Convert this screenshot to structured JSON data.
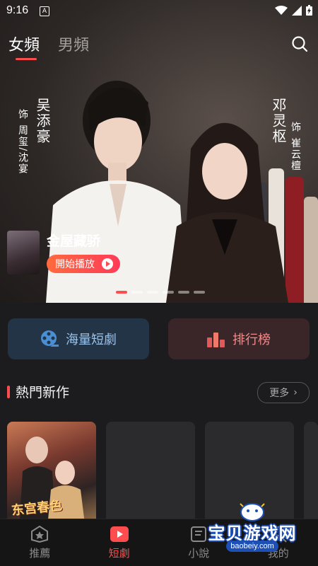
{
  "status_bar": {
    "time": "9:16",
    "app_badge": "A"
  },
  "tabs": [
    {
      "label": "女頻",
      "active": true
    },
    {
      "label": "男頻",
      "active": false
    }
  ],
  "hero": {
    "actor1_name": "吴添豪",
    "actor1_role": "饰 周玺/沈宴",
    "actor2_name": "邓灵枢",
    "actor2_role": "饰 崔云檀",
    "drama_title": "金屋藏骄",
    "play_label": "開始播放",
    "carousel_count": 6,
    "carousel_active_index": 0
  },
  "quick_actions": [
    {
      "label": "海量短劇",
      "icon": "film-reel-icon"
    },
    {
      "label": "排行榜",
      "icon": "ranking-icon"
    }
  ],
  "section": {
    "title": "熱門新作",
    "more_label": "更多"
  },
  "cards": [
    {
      "title": "东宫春色"
    }
  ],
  "nav": [
    {
      "label": "推薦",
      "icon": "recommend-icon",
      "active": false
    },
    {
      "label": "短劇",
      "icon": "play-icon",
      "active": true
    },
    {
      "label": "小說",
      "icon": "book-icon",
      "active": false
    },
    {
      "label": "我的",
      "icon": "profile-icon",
      "active": false
    }
  ],
  "watermark": {
    "text": "宝贝游戏网",
    "url": "baobeiy.com"
  },
  "colors": {
    "accent": "#ff4d4f",
    "background": "#1c1c1e"
  }
}
